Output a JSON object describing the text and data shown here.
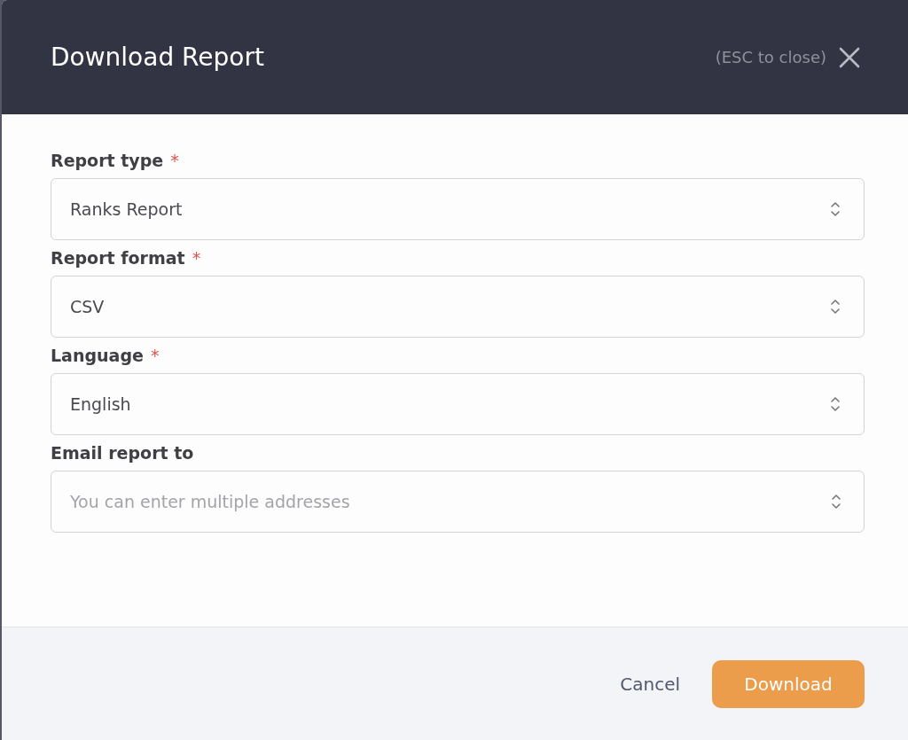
{
  "dialog": {
    "title": "Download Report",
    "close_hint": "(ESC to close)"
  },
  "fields": [
    {
      "label": "Report type",
      "required_mark": "*",
      "kind": "select",
      "value": "Ranks Report"
    },
    {
      "label": "Report format",
      "required_mark": "*",
      "kind": "select",
      "value": "CSV"
    },
    {
      "label": "Language",
      "required_mark": "*",
      "kind": "select",
      "value": "English"
    },
    {
      "label": "Email report to",
      "kind": "multi-input",
      "placeholder": "You can enter multiple addresses"
    }
  ],
  "buttons": [
    {
      "label": "Cancel",
      "kind": "secondary"
    },
    {
      "label": "Download",
      "kind": "primary"
    }
  ]
}
